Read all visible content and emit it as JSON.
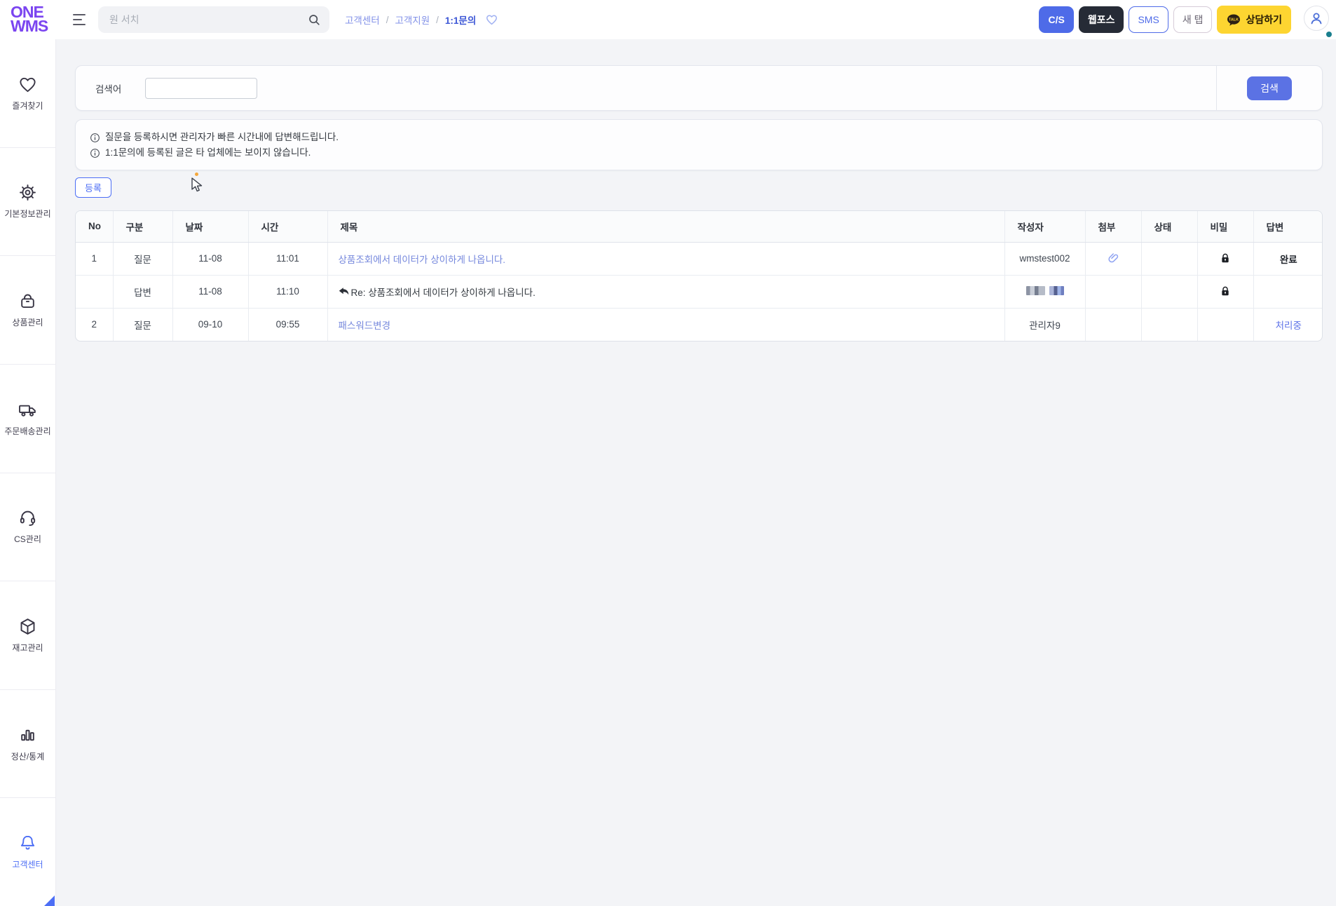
{
  "header": {
    "logo_line1": "ONE",
    "logo_line2": "WMS",
    "search_placeholder": "원 서치",
    "breadcrumb": {
      "separator": "/",
      "items": [
        {
          "id": "customer-center",
          "label": "고객센터",
          "current": false
        },
        {
          "id": "customer-support",
          "label": "고객지원",
          "current": false
        },
        {
          "id": "one-to-one-inquiry",
          "label": "1:1문의",
          "current": true
        }
      ]
    },
    "actions": [
      {
        "id": "cs",
        "label": "C/S",
        "style": "primary"
      },
      {
        "id": "webpos",
        "label": "웹포스",
        "style": "dark"
      },
      {
        "id": "sms",
        "label": "SMS",
        "style": "outline-blue"
      },
      {
        "id": "new-tab",
        "label": "새 탭",
        "style": "outline-gray"
      },
      {
        "id": "consult",
        "label": "상담하기",
        "style": "kakao",
        "badge": "TALK"
      }
    ]
  },
  "sidebar": {
    "items": [
      {
        "id": "favorites",
        "label": "즐겨찾기",
        "icon": "heart-icon",
        "active": false
      },
      {
        "id": "basic-info",
        "label": "기본정보관리",
        "icon": "gear-icon",
        "active": false
      },
      {
        "id": "product",
        "label": "상품관리",
        "icon": "bag-icon",
        "active": false
      },
      {
        "id": "order-delivery",
        "label": "주문배송관리",
        "icon": "truck-icon",
        "active": false
      },
      {
        "id": "cs-mgmt",
        "label": "CS관리",
        "icon": "headset-icon",
        "active": false
      },
      {
        "id": "inventory",
        "label": "재고관리",
        "icon": "cube-icon",
        "active": false
      },
      {
        "id": "settlement-stats",
        "label": "정산/통계",
        "icon": "bar-chart-icon",
        "active": false
      },
      {
        "id": "customer-center",
        "label": "고객센터",
        "icon": "bell-icon",
        "active": true
      }
    ]
  },
  "search_panel": {
    "label": "검색어",
    "input_value": "",
    "button_label": "검색"
  },
  "notice": {
    "lines": [
      "질문을 등록하시면 관리자가 빠른 시간내에 답변해드립니다.",
      "1:1문의에 등록된 글은 타 업체에는 보이지 않습니다."
    ]
  },
  "register_button_label": "등록",
  "table": {
    "columns": [
      "No",
      "구분",
      "날짜",
      "시간",
      "제목",
      "작성자",
      "첨부",
      "상태",
      "비밀",
      "답변"
    ],
    "rows": [
      {
        "no": "1",
        "type": "질문",
        "date": "11-08",
        "time": "11:01",
        "title": "상품조회에서 데이터가 상이하게 나옵니다.",
        "title_is_link": true,
        "title_reply_arrow": false,
        "author": "wmstest002",
        "author_redacted": false,
        "attachment": true,
        "status": "",
        "secret": true,
        "reply": "완료",
        "reply_style": "done"
      },
      {
        "no": "",
        "type": "답변",
        "date": "11-08",
        "time": "11:10",
        "title": "Re: 상품조회에서 데이터가 상이하게 나옵니다.",
        "title_is_link": false,
        "title_reply_arrow": true,
        "author": "",
        "author_redacted": true,
        "attachment": false,
        "status": "",
        "secret": true,
        "reply": "",
        "reply_style": ""
      },
      {
        "no": "2",
        "type": "질문",
        "date": "09-10",
        "time": "09:55",
        "title": "패스워드변경",
        "title_is_link": true,
        "title_reply_arrow": false,
        "author": "관리자9",
        "author_redacted": false,
        "attachment": false,
        "status": "",
        "secret": false,
        "reply": "처리중",
        "reply_style": "pending"
      }
    ]
  },
  "colors": {
    "brand_purple": "#7b45f0",
    "accent_blue": "#4e6be8",
    "search_button_blue": "#5b72e4",
    "dark_button": "#262b36",
    "kakao_yellow": "#fdd531",
    "link_blue": "#7688dd",
    "active_sidebar": "#4c6ef5",
    "status_dot_teal": "#1a7f8e"
  }
}
